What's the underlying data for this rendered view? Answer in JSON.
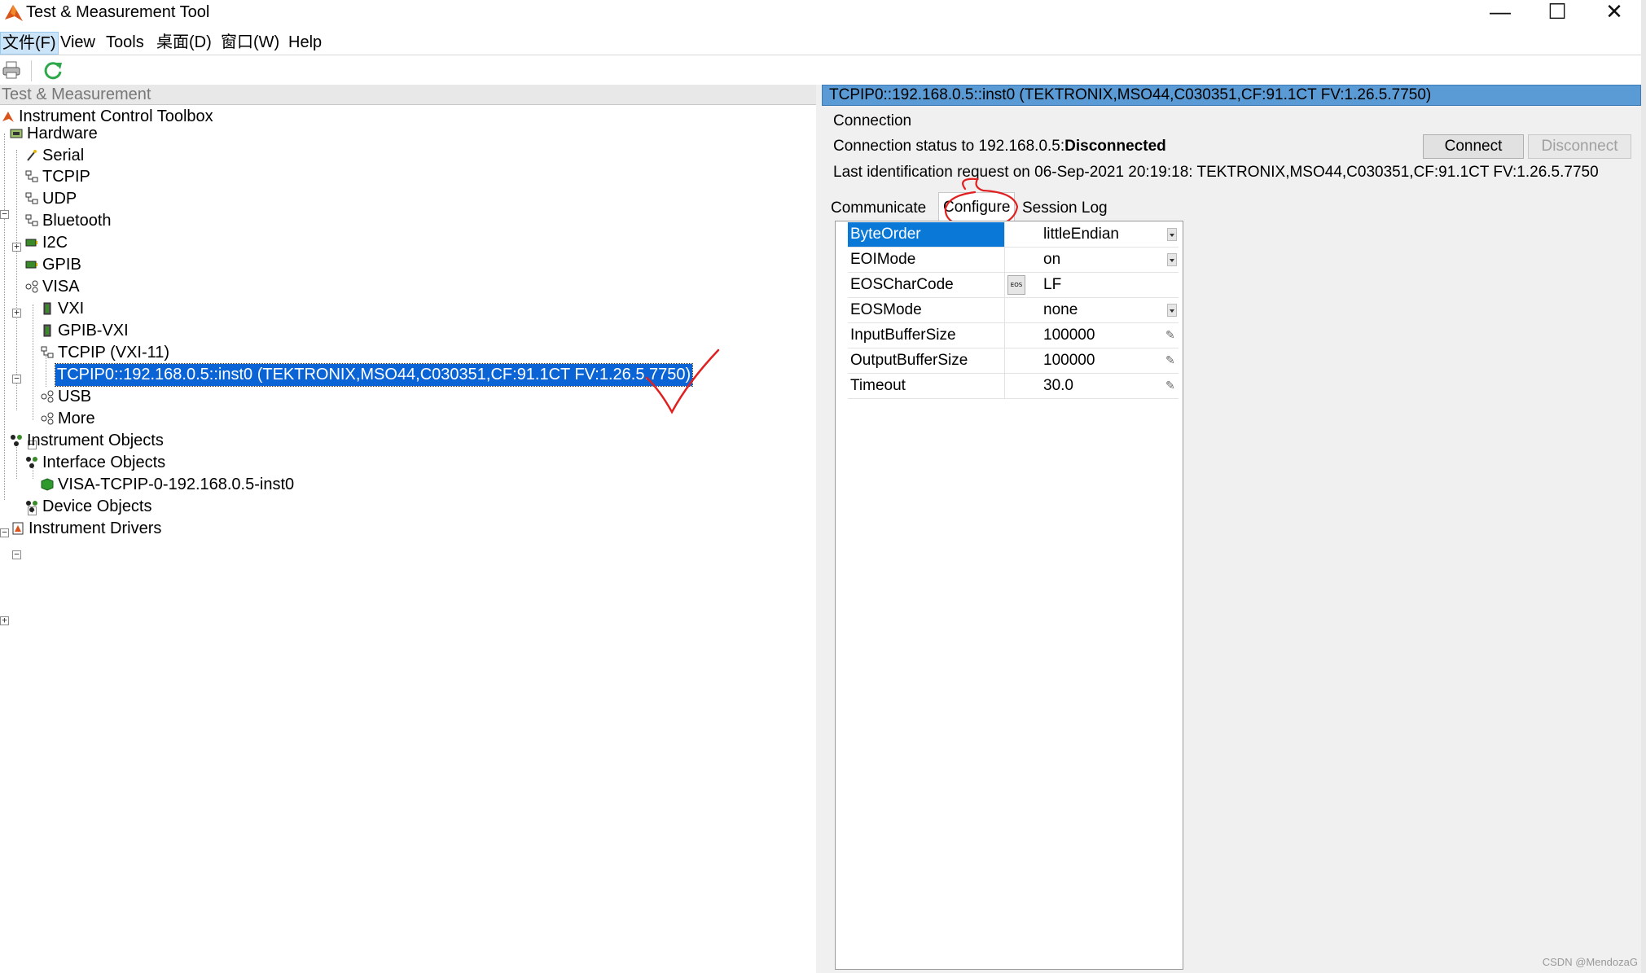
{
  "window": {
    "title": "Test & Measurement Tool",
    "controls": {
      "minimize": "—",
      "maximize": "☐",
      "close": "✕"
    }
  },
  "menu": {
    "items": [
      "文件(F)",
      "View",
      "Tools",
      "桌面(D)",
      "窗口(W)",
      "Help"
    ]
  },
  "toolbar": {
    "icons": [
      "printer-icon",
      "refresh-icon"
    ],
    "refresh_color": "#2ea84b"
  },
  "tree": {
    "header": "Test & Measurement",
    "nodes": {
      "root": "Instrument Control Toolbox",
      "hardware": "Hardware",
      "serial": "Serial",
      "tcpip": "TCPIP",
      "udp": "UDP",
      "bluetooth": "Bluetooth",
      "i2c": "I2C",
      "gpib": "GPIB",
      "visa": "VISA",
      "vxi": "VXI",
      "gpib_vxi": "GPIB-VXI",
      "tcpip_vxi": "TCPIP (VXI-11)",
      "selected_instrument": "TCPIP0::192.168.0.5::inst0 (TEKTRONIX,MSO44,C030351,CF:91.1CT FV:1.26.5.7750)",
      "usb": "USB",
      "more": "More",
      "instrument_objects": "Instrument Objects",
      "interface_objects": "Interface Objects",
      "visa_object": "VISA-TCPIP-0-192.168.0.5-inst0",
      "device_objects": "Device Objects",
      "instrument_drivers": "Instrument Drivers"
    }
  },
  "detail": {
    "header": "TCPIP0::192.168.0.5::inst0 (TEKTRONIX,MSO44,C030351,CF:91.1CT FV:1.26.5.7750)",
    "connection_title": "Connection",
    "status_prefix": "Connection status to 192.168.0.5:",
    "status_value": "Disconnected",
    "last_ident": "Last identification request on 06-Sep-2021 20:19:18: TEKTRONIX,MSO44,C030351,CF:91.1CT FV:1.26.5.7750",
    "connect_label": "Connect",
    "disconnect_label": "Disconnect",
    "tabs": [
      "Communicate",
      "Configure",
      "Session Log"
    ],
    "active_tab": "Configure",
    "properties": [
      {
        "name": "ByteOrder",
        "value": "littleEndian",
        "editor": "dropdown"
      },
      {
        "name": "EOIMode",
        "value": "on",
        "editor": "dropdown"
      },
      {
        "name": "EOSCharCode",
        "value": "LF",
        "editor": "eos"
      },
      {
        "name": "EOSMode",
        "value": "none",
        "editor": "dropdown"
      },
      {
        "name": "InputBufferSize",
        "value": "100000",
        "editor": "edit"
      },
      {
        "name": "OutputBufferSize",
        "value": "100000",
        "editor": "edit"
      },
      {
        "name": "Timeout",
        "value": "30.0",
        "editor": "edit"
      }
    ],
    "eos_button_text": "EOS"
  },
  "watermark": "CSDN @MendozaG",
  "colors": {
    "selection": "#0a64d6",
    "header_blue": "#5b9bd5",
    "annotation_red": "#e02020"
  }
}
